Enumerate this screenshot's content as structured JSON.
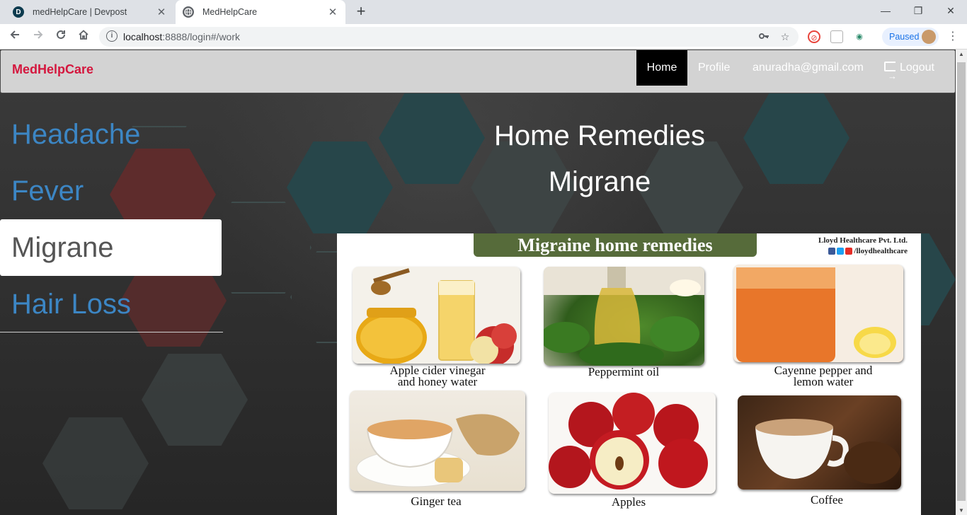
{
  "browser": {
    "tabs": [
      {
        "title": "medHelpCare | Devpost",
        "icon": "devpost-favicon-icon",
        "favicon_letter": "D",
        "active": false
      },
      {
        "title": "MedHelpCare",
        "icon": "globe-icon",
        "favicon_letter": "",
        "active": true
      }
    ],
    "close_glyph": "✕",
    "new_tab_glyph": "+",
    "window_controls": {
      "minimize": "—",
      "maximize": "❐",
      "close": "✕"
    },
    "url_host": "localhost",
    "url_rest": ":8888/login#/work",
    "paused_label": "Paused"
  },
  "navbar": {
    "brand": "MedHelpCare",
    "brand_color": "#d4173e",
    "links": {
      "home": "Home",
      "profile": "Profile",
      "email": "anuradha@gmail.com",
      "logout": "Logout"
    }
  },
  "sidebar": {
    "items": [
      {
        "label": "Headache",
        "active": false
      },
      {
        "label": "Fever",
        "active": false
      },
      {
        "label": "Migrane",
        "active": true
      },
      {
        "label": "Hair Loss",
        "active": false
      }
    ],
    "link_color": "#3c86c4"
  },
  "main": {
    "title": "Home Remedies",
    "subtitle": "Migrane"
  },
  "infographic": {
    "banner": "Migraine home remedies",
    "company": "Lloyd Healthcare Pvt. Ltd.",
    "social_handle": "/lloydhealthcare",
    "remedies": [
      {
        "line1": "Apple cider vinegar",
        "line2": "and honey water"
      },
      {
        "line1": "Peppermint oil",
        "line2": ""
      },
      {
        "line1": "Cayenne pepper and",
        "line2": "lemon water"
      },
      {
        "line1": "Ginger tea",
        "line2": ""
      },
      {
        "line1": "Apples",
        "line2": ""
      },
      {
        "line1": "Coffee",
        "line2": ""
      }
    ]
  }
}
